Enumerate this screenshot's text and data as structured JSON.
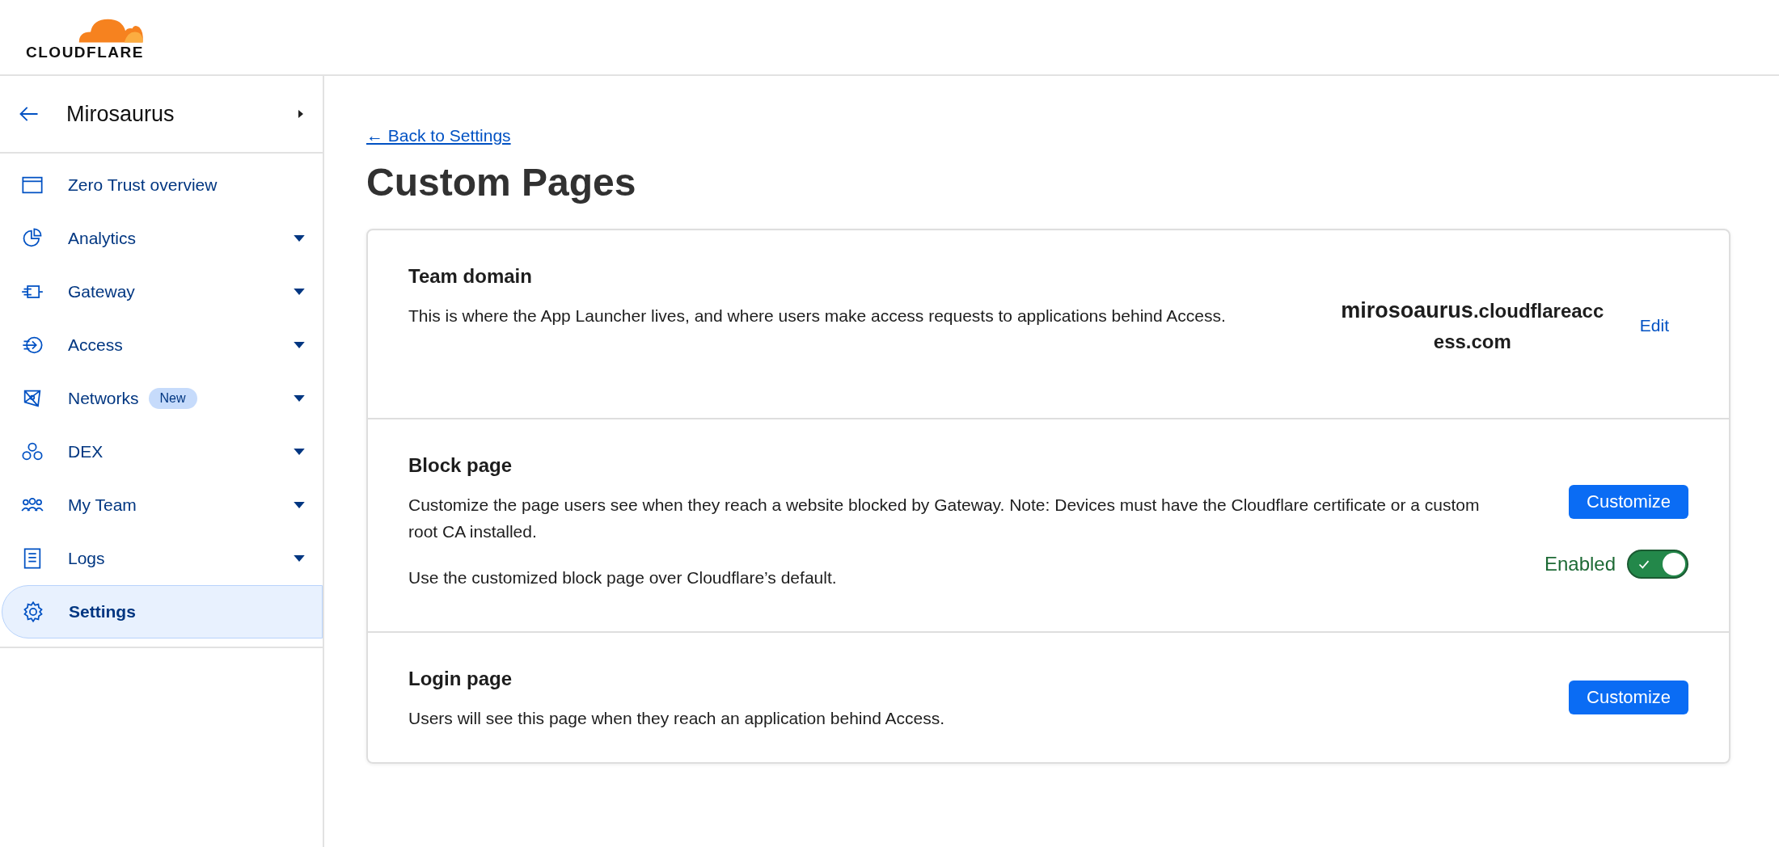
{
  "header": {
    "logo_text": "CLOUDFLARE"
  },
  "sidebar": {
    "account": "Mirosaurus",
    "items": [
      {
        "label": "Zero Trust overview",
        "expandable": false,
        "selected": false
      },
      {
        "label": "Analytics",
        "expandable": true,
        "selected": false
      },
      {
        "label": "Gateway",
        "expandable": true,
        "selected": false
      },
      {
        "label": "Access",
        "expandable": true,
        "selected": false
      },
      {
        "label": "Networks",
        "badge": "New",
        "expandable": true,
        "selected": false
      },
      {
        "label": "DEX",
        "expandable": true,
        "selected": false
      },
      {
        "label": "My Team",
        "expandable": true,
        "selected": false
      },
      {
        "label": "Logs",
        "expandable": true,
        "selected": false
      },
      {
        "label": "Settings",
        "expandable": false,
        "selected": true
      }
    ]
  },
  "back_link": "← Back to Settings",
  "title": "Custom Pages",
  "sections": [
    {
      "kind": "domain",
      "heading": "Team domain",
      "description": "This is where the App Launcher lives, and where users make access requests to applications behind Access.",
      "subdomain": "mirosoaurus",
      "suffix": ".cloudflareaccess.com",
      "action": "Edit"
    },
    {
      "kind": "block",
      "heading": "Block page",
      "description": "Customize the page users see when they reach a website blocked by Gateway. Note: Devices must have the Cloudflare certificate or a custom root CA installed.",
      "note": "Use the customized block page over Cloudflare’s default.",
      "action": "Customize",
      "toggle": {
        "label": "Enabled",
        "on": true
      }
    },
    {
      "kind": "login",
      "heading": "Login page",
      "description": "Users will see this page when they reach an application behind Access.",
      "action": "Customize"
    }
  ]
}
